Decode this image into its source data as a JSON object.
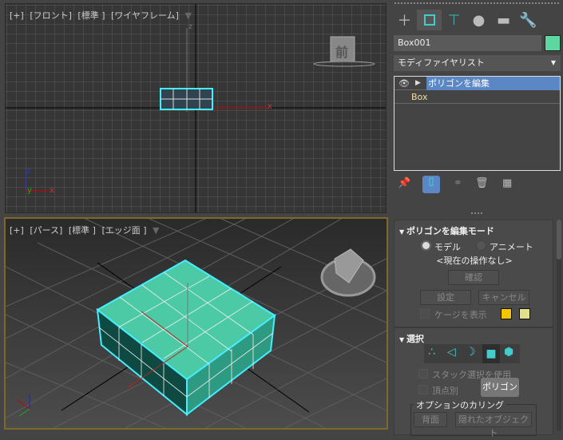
{
  "viewport_front": {
    "labels": [
      "[+]",
      "[フロント]",
      "[標準 ]",
      "[ワイヤフレーム]"
    ],
    "viewcube_label": "前",
    "axis_x": "x",
    "axis_y": "y",
    "axis_z": "z"
  },
  "viewport_perspective": {
    "labels": [
      "[+]",
      "[パース]",
      "[標準 ]",
      "[エッジ面 ]"
    ],
    "axis_x": "x",
    "axis_y": "y",
    "axis_z": "z"
  },
  "panel": {
    "tabs": [
      "create",
      "modify",
      "hierarchy",
      "motion",
      "display",
      "utilities"
    ],
    "object_name": "Box001",
    "object_color": "#5dd6a0",
    "modifier_list": "モディファイヤリスト",
    "stack": [
      {
        "label": "ポリゴンを編集",
        "selected": true
      },
      {
        "label": "Box",
        "selected": false
      }
    ],
    "edit_poly_mode": {
      "title": "ポリゴンを編集モード",
      "radio_model": "モデル",
      "radio_animate": "アニメート",
      "current_op": "<現在の操作なし>",
      "commit": "確認",
      "settings": "設定",
      "cancel": "キャンセル",
      "show_cage": "ケージを表示",
      "cage_colors": [
        "#f5c400",
        "#e2e28a"
      ]
    },
    "selection": {
      "title": "選択",
      "use_stack_selection": "スタック選択を使用",
      "by_vertex": "頂点別",
      "tooltip": "ポリゴン",
      "culling_group": "オプションのカリング",
      "backface": "背面",
      "hidden_objects": "隠れたオブジェクト"
    }
  }
}
